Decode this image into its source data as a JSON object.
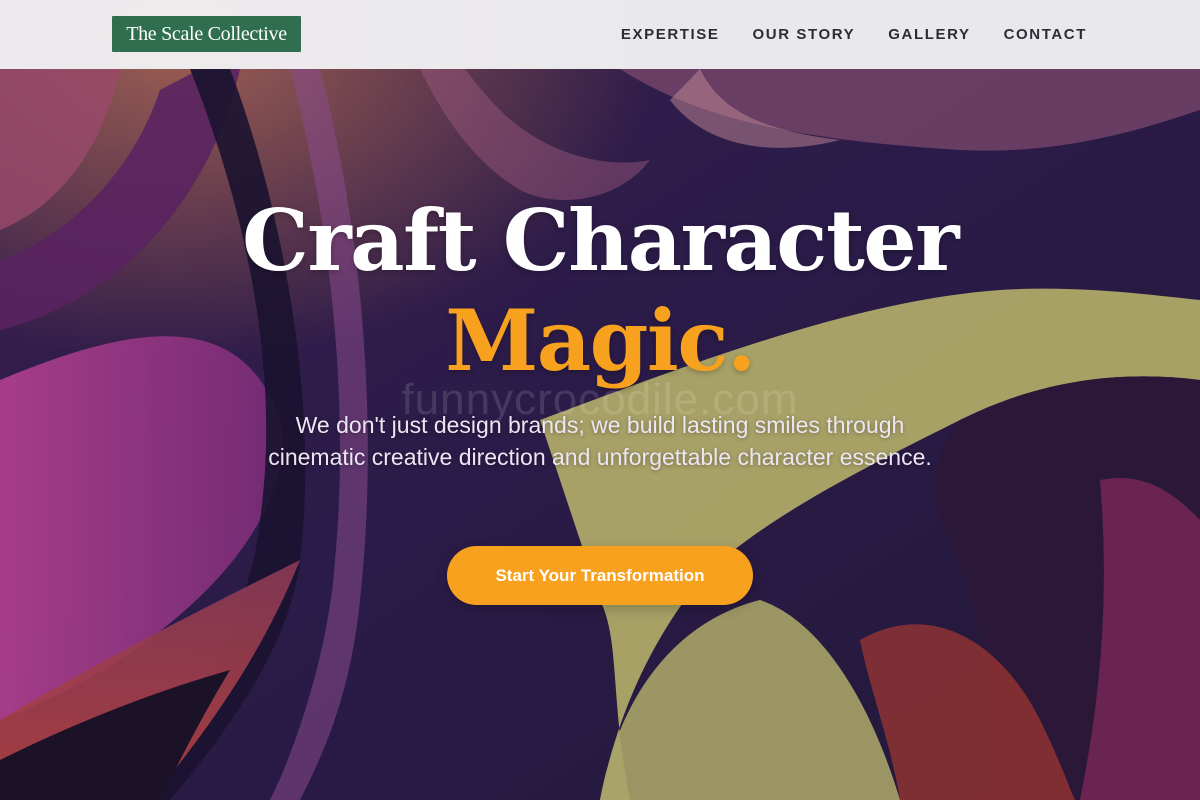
{
  "brand": {
    "logo_text": "The Scale Collective",
    "logo_bg": "#2f6e4e"
  },
  "nav": {
    "items": [
      {
        "label": "EXPERTISE"
      },
      {
        "label": "OUR STORY"
      },
      {
        "label": "GALLERY"
      },
      {
        "label": "CONTACT"
      }
    ]
  },
  "hero": {
    "title_line1": "Craft Character",
    "title_line2": "Magic.",
    "title_accent_color": "#f7a11e",
    "watermark": "funnycrocodile.com",
    "subtitle": "We don't just design brands; we build lasting smiles through cinematic creative direction and unforgettable character essence.",
    "cta_label": "Start Your Transformation",
    "cta_color": "#f7a11e"
  }
}
